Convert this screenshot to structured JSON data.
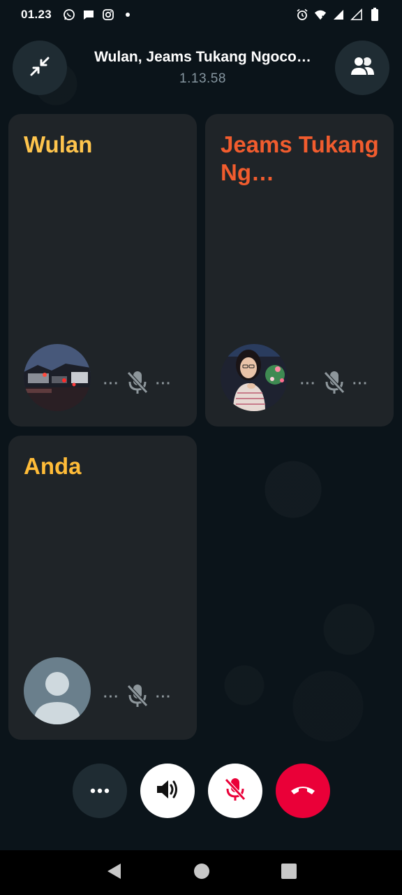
{
  "status_bar": {
    "time": "01.23",
    "left_icons": [
      "whatsapp-icon",
      "message-icon",
      "instagram-icon",
      "dot-icon"
    ],
    "right_icons": [
      "alarm-icon",
      "wifi-icon",
      "signal-icon",
      "signal-icon-2",
      "battery-icon"
    ]
  },
  "header": {
    "title": "Wulan, Jeams Tukang Ngoco…",
    "timer": "1.13.58"
  },
  "participants": [
    {
      "name": "Wulan",
      "name_color": "#ffc54d",
      "avatar": "street-night-photo",
      "status": "muted"
    },
    {
      "name": "Jeams Tukang Ng…",
      "name_color": "#f15c2e",
      "avatar": "girl-photo",
      "status": "muted"
    },
    {
      "name": "Anda",
      "name_color": "#ffbc38",
      "avatar": "default-avatar",
      "status": "muted"
    }
  ],
  "controls": [
    "more-options",
    "speaker",
    "microphone-muted",
    "end-call"
  ],
  "colors": {
    "background": "#0b141a",
    "tile": "#1f2428",
    "end_call": "#ea0038",
    "muted_icon": "#ea0038"
  }
}
